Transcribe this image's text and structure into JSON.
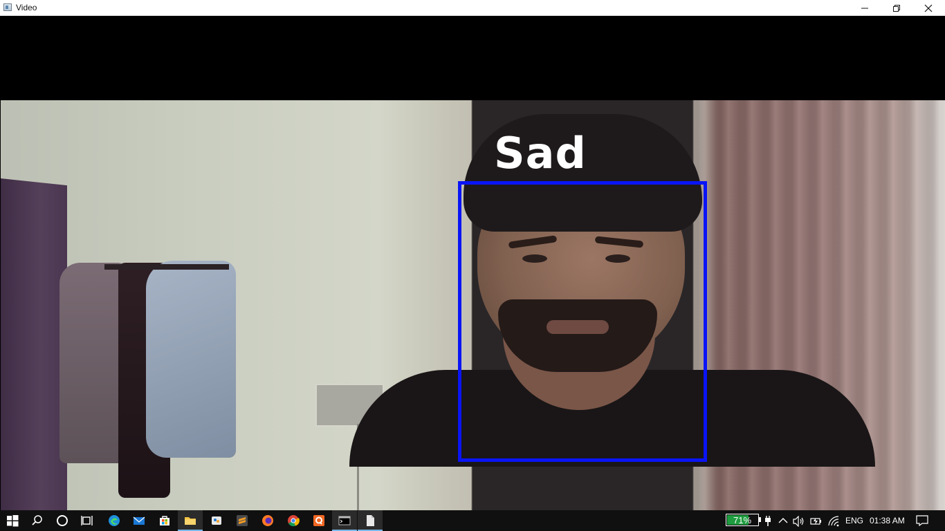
{
  "window": {
    "title": "Video"
  },
  "video": {
    "emotion_label": "Sad",
    "box_color": "#0a14f5"
  },
  "taskbar": {
    "apps": [
      "start-icon",
      "search-icon",
      "cortana-icon",
      "task-view-icon",
      "edge-icon",
      "mail-icon",
      "store-icon",
      "file-explorer-icon",
      "paint-icon",
      "sublime-icon",
      "firefox-icon",
      "chrome-icon",
      "q-app-icon",
      "command-prompt-icon",
      "document-icon"
    ],
    "battery_percent": "71%",
    "battery_level": 0.71,
    "battery_color": "#1e9c3f",
    "language": "ENG",
    "time": "01:38 AM"
  }
}
